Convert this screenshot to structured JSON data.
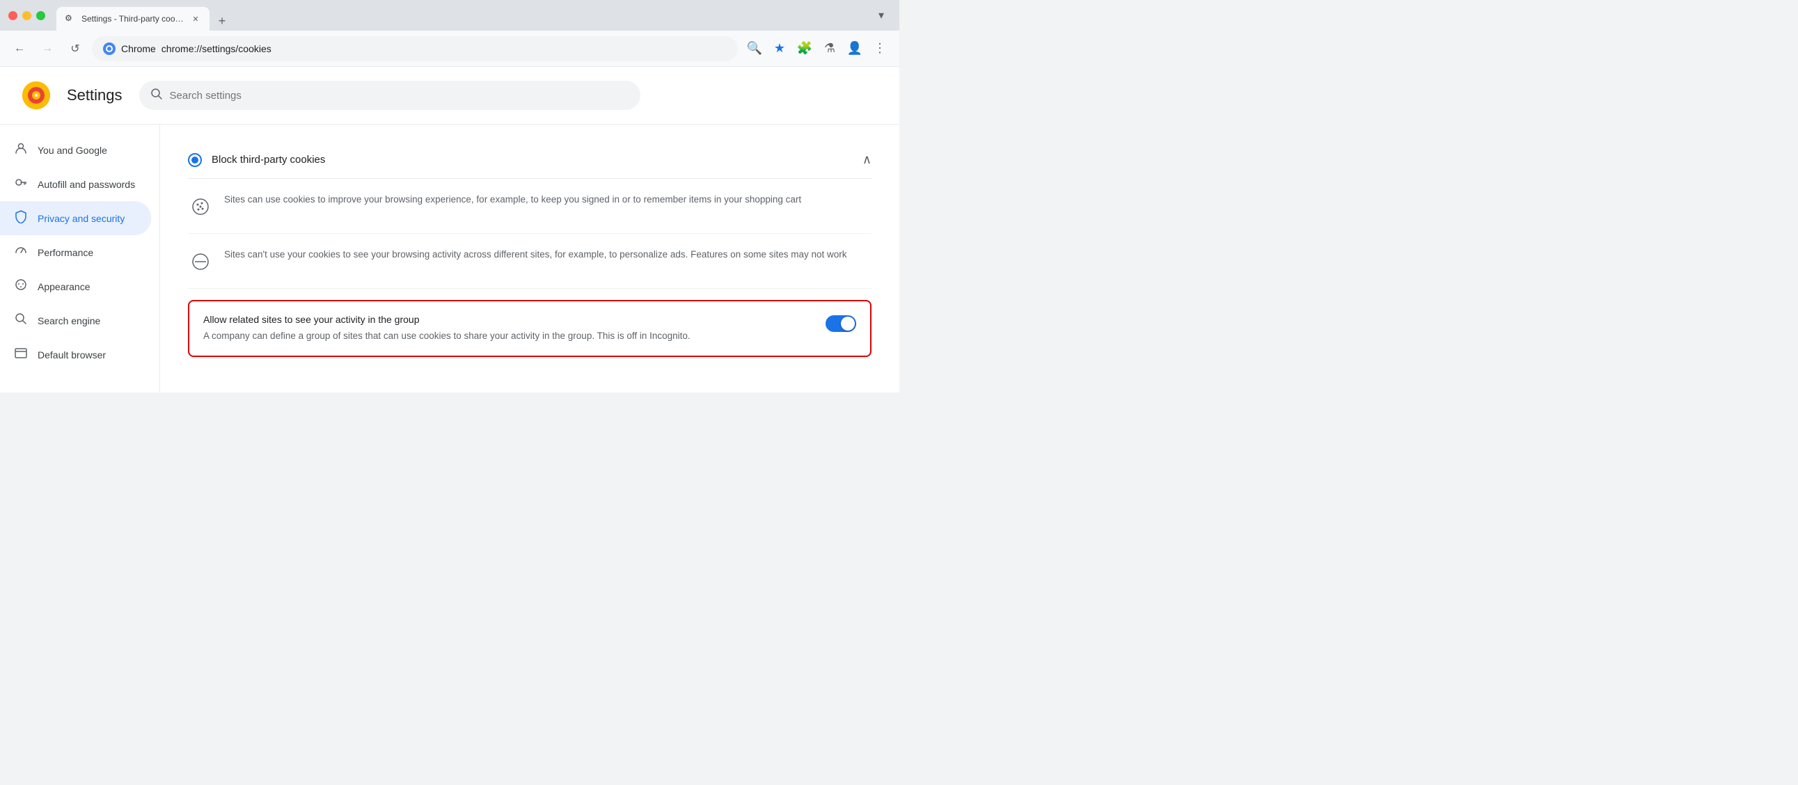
{
  "browser": {
    "tab_title": "Settings - Third-party cookie",
    "tab_favicon": "⚙",
    "new_tab_label": "+",
    "dropdown_label": "▾",
    "nav": {
      "back_label": "←",
      "forward_label": "→",
      "reload_label": "↺",
      "brand": "Chrome",
      "url": "chrome://settings/cookies",
      "search_icon": "🔍",
      "star_icon": "★",
      "extensions_icon": "🧩",
      "lab_icon": "⚗",
      "profile_icon": "👤",
      "menu_icon": "⋮"
    }
  },
  "settings": {
    "logo_letter": "",
    "title": "Settings",
    "search_placeholder": "Search settings",
    "sidebar": {
      "items": [
        {
          "id": "you-and-google",
          "label": "You and Google",
          "icon": "person"
        },
        {
          "id": "autofill",
          "label": "Autofill and passwords",
          "icon": "key"
        },
        {
          "id": "privacy",
          "label": "Privacy and security",
          "icon": "shield",
          "active": true
        },
        {
          "id": "performance",
          "label": "Performance",
          "icon": "gauge"
        },
        {
          "id": "appearance",
          "label": "Appearance",
          "icon": "palette"
        },
        {
          "id": "search",
          "label": "Search engine",
          "icon": "search"
        },
        {
          "id": "default-browser",
          "label": "Default browser",
          "icon": "browser"
        }
      ]
    },
    "content": {
      "section_title": "Block third-party cookies",
      "desc1": "Sites can use cookies to improve your browsing experience, for example, to keep you signed in or to remember items in your shopping cart",
      "desc2": "Sites can't use your cookies to see your browsing activity across different sites, for example, to personalize ads. Features on some sites may not work",
      "highlight_title": "Allow related sites to see your activity in the group",
      "highlight_desc": "A company can define a group of sites that can use cookies to share your activity in the group. This is off in Incognito.",
      "toggle_enabled": true
    }
  }
}
